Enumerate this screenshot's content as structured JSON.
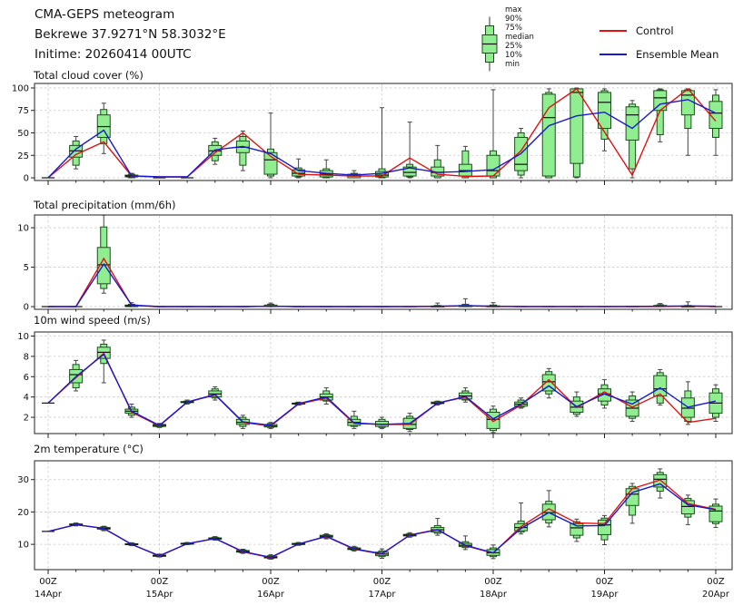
{
  "header": {
    "title": "CMA-GEPS meteogram",
    "location": "Bekrewe 37.9271°N 58.3032°E",
    "inittime": "Initime: 20260414 00UTC"
  },
  "legend": {
    "box_labels": [
      "max",
      "90%",
      "75%",
      "median",
      "25%",
      "10%",
      "min"
    ],
    "control_label": "Control",
    "ensemble_label": "Ensemble Mean",
    "control_color": "#e01212",
    "ensemble_color": "#1a1acc",
    "box_fill": "#90ee90",
    "box_edge": "#1e4d1e"
  },
  "time_axis": {
    "n_points": 25,
    "step_hours": 6,
    "major_every": 4,
    "major_labels": [
      {
        "z": "00Z",
        "d": "14Apr"
      },
      {
        "z": "00Z",
        "d": "15Apr"
      },
      {
        "z": "00Z",
        "d": "16Apr"
      },
      {
        "z": "00Z",
        "d": "17Apr"
      },
      {
        "z": "00Z",
        "d": "18Apr"
      },
      {
        "z": "00Z",
        "d": "19Apr"
      },
      {
        "z": "00Z",
        "d": "20Apr"
      }
    ]
  },
  "chart_data": [
    {
      "type": "boxplot+lines",
      "title": "Total cloud cover (%)",
      "ylim": [
        -3,
        105
      ],
      "yticks": [
        0,
        25,
        50,
        75,
        100
      ],
      "boxes": [
        [
          0,
          0,
          0,
          0,
          0,
          0,
          0
        ],
        [
          10,
          14,
          23,
          30,
          36,
          41,
          46
        ],
        [
          27,
          38,
          45,
          57,
          70,
          76,
          83
        ],
        [
          0,
          0,
          1,
          2,
          3,
          4,
          5
        ],
        [
          0,
          0,
          0,
          0,
          0,
          0,
          0
        ],
        [
          0,
          0,
          0,
          0,
          0,
          0,
          0
        ],
        [
          15,
          19,
          25,
          30,
          36,
          40,
          44
        ],
        [
          8,
          14,
          28,
          34,
          41,
          46,
          52
        ],
        [
          0,
          2,
          4,
          20,
          28,
          32,
          72
        ],
        [
          0,
          1,
          2,
          5,
          9,
          11,
          21
        ],
        [
          0,
          0,
          1,
          4,
          8,
          10,
          20
        ],
        [
          0,
          0,
          0,
          2,
          4,
          5,
          8
        ],
        [
          0,
          0,
          1,
          3,
          7,
          10,
          78
        ],
        [
          0,
          1,
          2,
          6,
          12,
          15,
          62
        ],
        [
          0,
          0,
          2,
          6,
          12,
          20,
          36
        ],
        [
          0,
          0,
          2,
          8,
          15,
          30,
          35
        ],
        [
          0,
          0,
          2,
          8,
          25,
          30,
          98
        ],
        [
          0,
          3,
          8,
          15,
          45,
          50,
          55
        ],
        [
          0,
          0,
          2,
          67,
          93,
          95,
          99
        ],
        [
          0,
          1,
          16,
          95,
          99,
          99,
          100
        ],
        [
          30,
          43,
          55,
          84,
          95,
          97,
          99
        ],
        [
          0,
          10,
          42,
          70,
          79,
          82,
          86
        ],
        [
          40,
          48,
          75,
          89,
          97,
          98,
          99
        ],
        [
          25,
          55,
          70,
          92,
          97,
          98,
          99
        ],
        [
          25,
          45,
          55,
          72,
          85,
          92,
          98
        ]
      ],
      "control": [
        0,
        26,
        40,
        2,
        1,
        1,
        28,
        50,
        24,
        4,
        3,
        2,
        2,
        22,
        4,
        1.5,
        2,
        30,
        78,
        99,
        51,
        3,
        75,
        99,
        63
      ],
      "mean": [
        0,
        32,
        53,
        2,
        1,
        1,
        31,
        35,
        27,
        8,
        5,
        3,
        5,
        11,
        6,
        7,
        9,
        27,
        58,
        69,
        73,
        55,
        82,
        87,
        72
      ]
    },
    {
      "type": "boxplot+lines",
      "title": "Total precipitation (mm/6h)",
      "ylim": [
        -0.34,
        11.62
      ],
      "yticks": [
        0,
        5,
        10
      ],
      "boxes": [
        [
          0,
          0,
          0,
          0,
          0,
          0,
          0
        ],
        [
          0,
          0,
          0,
          0,
          0,
          0,
          0
        ],
        [
          1.7,
          2.3,
          2.9,
          5.3,
          7.5,
          10.1,
          11.6
        ],
        [
          0,
          0,
          0,
          0.1,
          0.2,
          0.3,
          0.5
        ],
        [
          0,
          0,
          0,
          0,
          0,
          0,
          0
        ],
        [
          0,
          0,
          0,
          0,
          0,
          0,
          0
        ],
        [
          0,
          0,
          0,
          0,
          0,
          0,
          0
        ],
        [
          0,
          0,
          0,
          0,
          0,
          0,
          0
        ],
        [
          0,
          0,
          0,
          0.05,
          0.2,
          0.3,
          0.45
        ],
        [
          0,
          0,
          0,
          0,
          0,
          0,
          0
        ],
        [
          0,
          0,
          0,
          0,
          0,
          0,
          0
        ],
        [
          0,
          0,
          0,
          0,
          0,
          0,
          0
        ],
        [
          0,
          0,
          0,
          0,
          0,
          0,
          0
        ],
        [
          0,
          0,
          0,
          0,
          0,
          0,
          0
        ],
        [
          0,
          0,
          0,
          0.02,
          0.08,
          0.15,
          0.45
        ],
        [
          0,
          0,
          0,
          0.05,
          0.15,
          0.3,
          1.0
        ],
        [
          0,
          0,
          0,
          0.02,
          0.1,
          0.2,
          0.5
        ],
        [
          0,
          0,
          0,
          0,
          0,
          0,
          0
        ],
        [
          0,
          0,
          0,
          0,
          0,
          0,
          0
        ],
        [
          0,
          0,
          0,
          0,
          0,
          0,
          0
        ],
        [
          0,
          0,
          0,
          0,
          0,
          0,
          0
        ],
        [
          0,
          0,
          0,
          0,
          0,
          0,
          0
        ],
        [
          0,
          0,
          0,
          0.05,
          0.15,
          0.25,
          0.4
        ],
        [
          0,
          0,
          0,
          0.02,
          0.08,
          0.15,
          0.6
        ],
        [
          0,
          0,
          0,
          0,
          0,
          0,
          0
        ]
      ],
      "control": [
        0,
        0,
        6.1,
        0.15,
        0,
        0,
        0,
        0,
        0.05,
        0,
        0,
        0,
        0,
        0,
        0.03,
        0.1,
        0.03,
        0,
        0,
        0,
        0,
        0,
        0.02,
        0.05,
        0.02
      ],
      "mean": [
        0,
        0,
        5.4,
        0.2,
        0,
        0,
        0,
        0,
        0.05,
        0,
        0,
        0,
        0,
        0.02,
        0.05,
        0.12,
        0.05,
        0.02,
        0.02,
        0.02,
        0.02,
        0.03,
        0.05,
        0.08,
        0.05
      ]
    },
    {
      "type": "boxplot+lines",
      "title": "10m wind speed (m/s)",
      "ylim": [
        0.4,
        10.4
      ],
      "yticks": [
        2,
        4,
        6,
        8,
        10
      ],
      "boxes": [
        [
          3.4,
          3.4,
          3.4,
          3.4,
          3.4,
          3.4,
          3.4
        ],
        [
          4.6,
          4.9,
          5.4,
          6.2,
          6.7,
          7.2,
          7.6
        ],
        [
          5.4,
          7.3,
          7.8,
          8.4,
          8.9,
          9.2,
          9.6
        ],
        [
          2.0,
          2.2,
          2.4,
          2.6,
          2.8,
          3.0,
          3.3
        ],
        [
          1.0,
          1.05,
          1.1,
          1.2,
          1.3,
          1.35,
          1.4
        ],
        [
          3.3,
          3.4,
          3.45,
          3.5,
          3.55,
          3.6,
          3.7
        ],
        [
          3.7,
          3.9,
          4.0,
          4.3,
          4.6,
          4.8,
          5.0
        ],
        [
          0.9,
          1.1,
          1.3,
          1.5,
          1.8,
          2.0,
          2.2
        ],
        [
          0.9,
          1.0,
          1.05,
          1.15,
          1.3,
          1.4,
          1.5
        ],
        [
          3.2,
          3.25,
          3.3,
          3.35,
          3.4,
          3.45,
          3.5
        ],
        [
          3.3,
          3.6,
          3.7,
          4.0,
          4.3,
          4.6,
          4.9
        ],
        [
          0.9,
          1.1,
          1.2,
          1.5,
          1.8,
          2.1,
          2.6
        ],
        [
          0.9,
          1.0,
          1.1,
          1.3,
          1.6,
          1.8,
          2.0
        ],
        [
          0.6,
          0.8,
          0.9,
          1.3,
          1.9,
          2.1,
          2.4
        ],
        [
          3.2,
          3.3,
          3.35,
          3.4,
          3.5,
          3.55,
          3.6
        ],
        [
          3.5,
          3.7,
          3.8,
          4.1,
          4.4,
          4.6,
          4.9
        ],
        [
          0.5,
          0.7,
          0.9,
          1.8,
          2.5,
          2.8,
          3.1
        ],
        [
          2.9,
          3.0,
          3.1,
          3.3,
          3.5,
          3.7,
          3.9
        ],
        [
          3.9,
          4.3,
          4.6,
          5.5,
          6.2,
          6.5,
          6.8
        ],
        [
          2.1,
          2.3,
          2.5,
          3.0,
          3.6,
          4.0,
          4.5
        ],
        [
          2.9,
          3.2,
          3.6,
          4.3,
          4.8,
          5.2,
          5.7
        ],
        [
          1.6,
          1.9,
          2.1,
          2.9,
          3.7,
          4.1,
          4.5
        ],
        [
          3.2,
          3.4,
          4.1,
          4.8,
          6.1,
          6.4,
          6.7
        ],
        [
          1.3,
          1.6,
          2.0,
          2.9,
          3.9,
          4.6,
          5.5
        ],
        [
          1.6,
          2.0,
          2.4,
          3.4,
          4.4,
          4.8,
          5.2
        ]
      ],
      "control": [
        3.4,
        5.9,
        8.3,
        2.5,
        1.15,
        3.5,
        4.2,
        1.5,
        1.15,
        3.3,
        3.9,
        1.4,
        1.3,
        1.3,
        3.4,
        4.0,
        1.6,
        3.2,
        5.7,
        2.95,
        4.5,
        3.0,
        4.3,
        1.5,
        1.9
      ],
      "mean": [
        3.4,
        6.0,
        8.2,
        2.6,
        1.2,
        3.5,
        4.25,
        1.55,
        1.2,
        3.35,
        4.0,
        1.45,
        1.3,
        1.4,
        3.4,
        4.05,
        1.85,
        3.3,
        5.1,
        3.05,
        4.3,
        3.3,
        4.9,
        3.0,
        3.6
      ]
    },
    {
      "type": "boxplot+lines",
      "title": "2m temperature (°C)",
      "ylim": [
        2.2,
        35.8
      ],
      "yticks": [
        10,
        20,
        30
      ],
      "boxes": [
        [
          14.0,
          14.0,
          14.0,
          14.0,
          14.0,
          14.0,
          14.0
        ],
        [
          15.7,
          15.9,
          16.0,
          16.1,
          16.3,
          16.4,
          16.6
        ],
        [
          14.2,
          14.5,
          14.7,
          14.9,
          15.2,
          15.4,
          15.6
        ],
        [
          9.6,
          9.8,
          9.9,
          10.0,
          10.2,
          10.3,
          10.5
        ],
        [
          6.1,
          6.2,
          6.3,
          6.5,
          6.7,
          6.8,
          7.0
        ],
        [
          9.9,
          10.0,
          10.1,
          10.2,
          10.35,
          10.45,
          10.6
        ],
        [
          11.3,
          11.5,
          11.6,
          11.8,
          12.0,
          12.2,
          12.4
        ],
        [
          7.2,
          7.4,
          7.6,
          7.8,
          8.1,
          8.3,
          8.5
        ],
        [
          5.4,
          5.6,
          5.8,
          6.0,
          6.3,
          6.5,
          6.8
        ],
        [
          9.7,
          9.85,
          9.95,
          10.1,
          10.3,
          10.4,
          10.6
        ],
        [
          11.7,
          12.0,
          12.2,
          12.5,
          12.8,
          13.0,
          13.3
        ],
        [
          7.9,
          8.2,
          8.4,
          8.6,
          8.9,
          9.1,
          9.4
        ],
        [
          5.7,
          6.2,
          6.5,
          7.0,
          7.6,
          8.0,
          8.6
        ],
        [
          12.2,
          12.5,
          12.6,
          12.8,
          13.1,
          13.3,
          13.6
        ],
        [
          12.8,
          13.4,
          13.8,
          14.5,
          15.2,
          15.8,
          18.0
        ],
        [
          8.4,
          9.0,
          9.3,
          9.7,
          10.3,
          10.8,
          12.6
        ],
        [
          5.6,
          6.2,
          6.6,
          7.4,
          8.4,
          8.9,
          9.8
        ],
        [
          13.2,
          13.8,
          14.2,
          15.2,
          16.4,
          17.2,
          22.8
        ],
        [
          15.4,
          16.6,
          17.6,
          19.8,
          22.4,
          23.3,
          26.6
        ],
        [
          10.9,
          12.0,
          12.8,
          15.1,
          16.4,
          17.0,
          17.8
        ],
        [
          9.9,
          11.4,
          13.0,
          16.0,
          17.5,
          18.1,
          18.9
        ],
        [
          16.5,
          19.0,
          22.0,
          25.5,
          27.2,
          27.9,
          28.8
        ],
        [
          24.3,
          26.4,
          27.7,
          30.1,
          31.5,
          32.2,
          33.3
        ],
        [
          16.1,
          18.4,
          19.4,
          21.7,
          23.5,
          24.2,
          25.2
        ],
        [
          15.2,
          16.4,
          17.0,
          20.3,
          21.8,
          22.4,
          24.0
        ]
      ],
      "control": [
        14.0,
        16.1,
        14.9,
        10.0,
        6.4,
        10.2,
        11.8,
        7.7,
        5.9,
        10.1,
        12.4,
        8.5,
        7.0,
        12.9,
        14.6,
        9.6,
        7.3,
        15.5,
        21.0,
        16.6,
        16.4,
        27.2,
        29.9,
        22.6,
        20.8
      ],
      "mean": [
        14.0,
        16.1,
        14.9,
        10.0,
        6.5,
        10.2,
        11.8,
        7.8,
        6.0,
        10.1,
        12.5,
        8.6,
        7.1,
        12.8,
        14.5,
        9.7,
        7.4,
        14.9,
        19.8,
        15.7,
        15.8,
        26.0,
        28.7,
        22.2,
        20.7
      ]
    }
  ]
}
